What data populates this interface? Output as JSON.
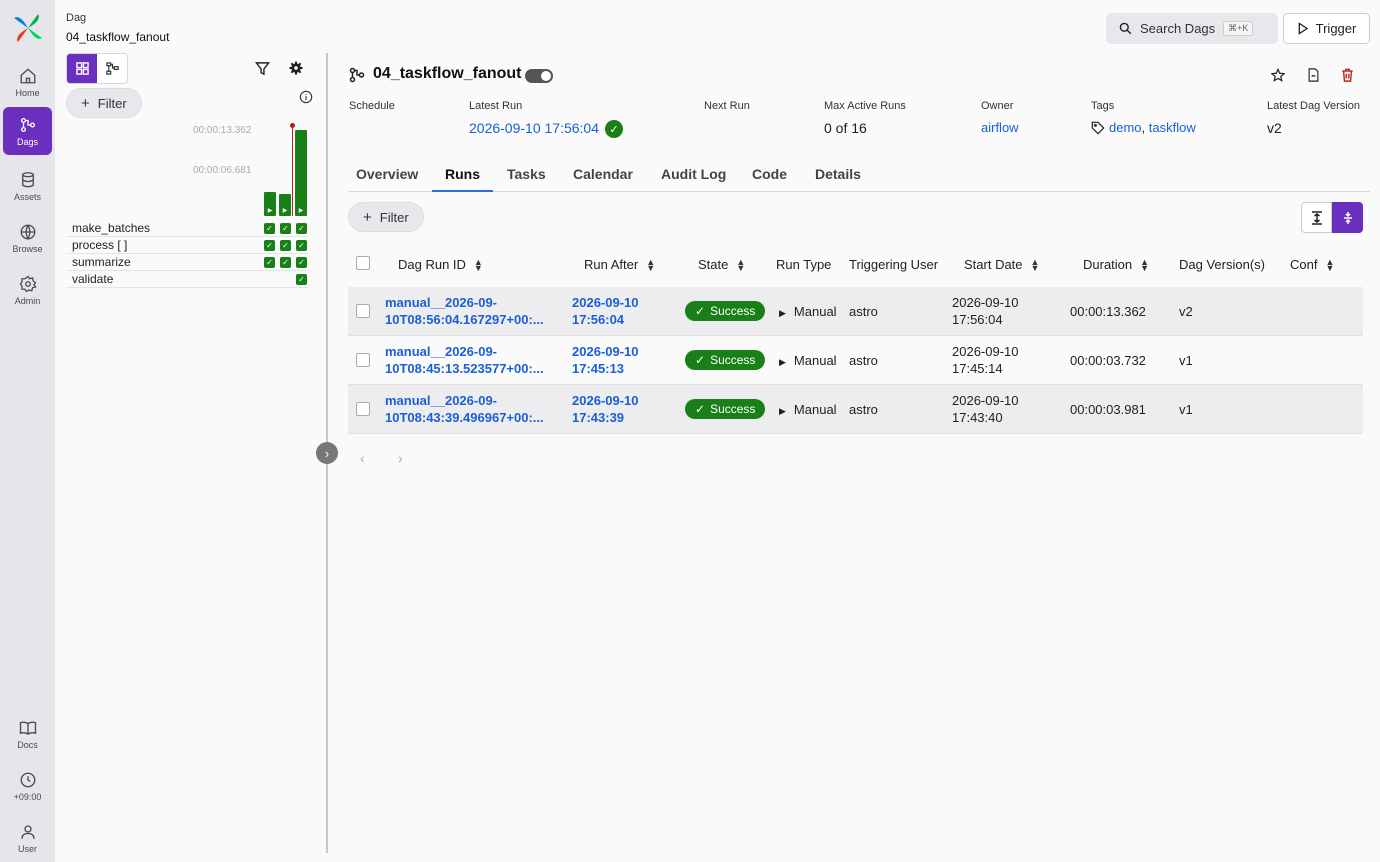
{
  "nav": {
    "items": [
      {
        "label": "Home",
        "icon": "home-icon"
      },
      {
        "label": "Dags",
        "icon": "dags-icon"
      },
      {
        "label": "Assets",
        "icon": "database-icon"
      },
      {
        "label": "Browse",
        "icon": "globe-icon"
      },
      {
        "label": "Admin",
        "icon": "gear-icon"
      }
    ],
    "bottom": [
      {
        "label": "Docs",
        "icon": "book-icon"
      },
      {
        "label": "+09:00",
        "icon": "clock-icon"
      },
      {
        "label": "User",
        "icon": "user-icon"
      }
    ]
  },
  "grid": {
    "label": "Dag",
    "dag_name": "04_taskflow_fanout",
    "filter_label": "Filter",
    "durations": [
      "00:00:13.362",
      "00:00:06.681"
    ],
    "run_bars": [
      0.28,
      0.26,
      1.0
    ],
    "tasks": [
      "make_batches",
      "process [ ]",
      "summarize",
      "validate"
    ]
  },
  "header": {
    "search_label": "Search Dags",
    "search_kbd": "⌘+K",
    "trigger_label": "Trigger",
    "title": "04_taskflow_fanout"
  },
  "meta": {
    "schedule_label": "Schedule",
    "latest_run_label": "Latest Run",
    "latest_run_value": "2026-09-10 17:56:04",
    "next_run_label": "Next Run",
    "max_active_label": "Max Active Runs",
    "max_active_value": "0 of 16",
    "owner_label": "Owner",
    "owner_value": "airflow",
    "tags_label": "Tags",
    "tag1": "demo",
    "tag_sep": ", ",
    "tag2": "taskflow",
    "version_label": "Latest Dag Version",
    "version_value": "v2"
  },
  "tabs": [
    "Overview",
    "Runs",
    "Tasks",
    "Calendar",
    "Audit Log",
    "Code",
    "Details"
  ],
  "runs": {
    "filter_label": "Filter",
    "columns": [
      "Dag Run ID",
      "Run After",
      "State",
      "Run Type",
      "Triggering User",
      "Start Date",
      "Duration",
      "Dag Version(s)",
      "Conf"
    ],
    "rows": [
      {
        "id1": "manual__2026-09-",
        "id2": "10T08:56:04.167297+00:...",
        "ra1": "2026-09-10",
        "ra2": "17:56:04",
        "state": "Success",
        "type": "Manual",
        "user": "astro",
        "sd1": "2026-09-10",
        "sd2": "17:56:04",
        "duration": "00:00:13.362",
        "version": "v2"
      },
      {
        "id1": "manual__2026-09-",
        "id2": "10T08:45:13.523577+00:...",
        "ra1": "2026-09-10",
        "ra2": "17:45:13",
        "state": "Success",
        "type": "Manual",
        "user": "astro",
        "sd1": "2026-09-10",
        "sd2": "17:45:14",
        "duration": "00:00:03.732",
        "version": "v1"
      },
      {
        "id1": "manual__2026-09-",
        "id2": "10T08:43:39.496967+00:...",
        "ra1": "2026-09-10",
        "ra2": "17:43:39",
        "state": "Success",
        "type": "Manual",
        "user": "astro",
        "sd1": "2026-09-10",
        "sd2": "17:43:40",
        "duration": "00:00:03.981",
        "version": "v1"
      }
    ]
  },
  "colors": {
    "accent": "#6b2fbf",
    "success": "#198017",
    "link": "#1a5fd6"
  }
}
